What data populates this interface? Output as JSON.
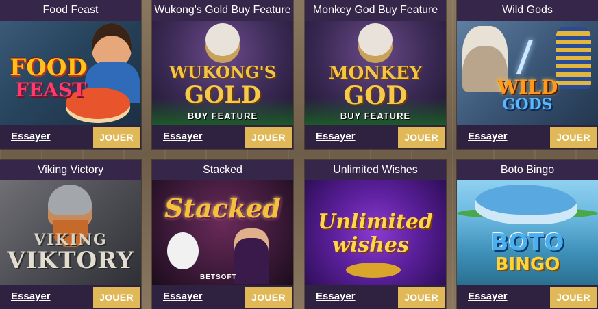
{
  "games": [
    {
      "title": "Food Feast",
      "try_label": "Essayer",
      "play_label": "JOUER",
      "art": {
        "line1": "FOOD",
        "line2": "FEAST",
        "sub": ""
      }
    },
    {
      "title": "Wukong's Gold Buy Feature",
      "try_label": "Essayer",
      "play_label": "JOUER",
      "art": {
        "line1": "WUKONG'S",
        "line2": "GOLD",
        "sub": "BUY FEATURE"
      }
    },
    {
      "title": "Monkey God Buy Feature",
      "try_label": "Essayer",
      "play_label": "JOUER",
      "art": {
        "line1": "MONKEY",
        "line2": "GOD",
        "sub": "BUY FEATURE"
      }
    },
    {
      "title": "Wild Gods",
      "try_label": "Essayer",
      "play_label": "JOUER",
      "art": {
        "line1": "WILD",
        "line2": "GODS",
        "sub": ""
      }
    },
    {
      "title": "Viking Victory",
      "try_label": "Essayer",
      "play_label": "JOUER",
      "art": {
        "line1": "VIKING",
        "line2": "VIKTORY",
        "sub": ""
      }
    },
    {
      "title": "Stacked",
      "try_label": "Essayer",
      "play_label": "JOUER",
      "art": {
        "line1": "Stacked",
        "line2": "",
        "sub": "BETSOFT"
      }
    },
    {
      "title": "Unlimited Wishes",
      "try_label": "Essayer",
      "play_label": "JOUER",
      "art": {
        "line1": "Unlimited",
        "line2": "wishes",
        "sub": ""
      }
    },
    {
      "title": "Boto Bingo",
      "try_label": "Essayer",
      "play_label": "JOUER",
      "art": {
        "line1": "BOTO",
        "line2": "BINGO",
        "sub": ""
      }
    }
  ],
  "colors": {
    "card_bg": "#2e2240",
    "play_button": "#e0b857",
    "page_bg": "#7b6a55"
  }
}
